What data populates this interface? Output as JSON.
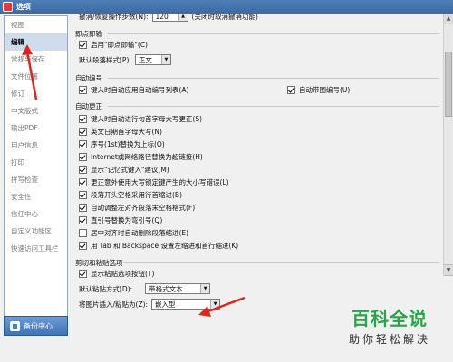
{
  "window": {
    "title": "选项"
  },
  "sidebar": {
    "items": [
      {
        "label": "视图"
      },
      {
        "label": "编辑"
      },
      {
        "label": "常规与保存"
      },
      {
        "label": "文件位置"
      },
      {
        "label": "修订"
      },
      {
        "label": "中文版式"
      },
      {
        "label": "输出PDF"
      },
      {
        "label": "用户信息"
      },
      {
        "label": "打印"
      },
      {
        "label": "拼写检查"
      },
      {
        "label": "安全性"
      },
      {
        "label": "信任中心"
      },
      {
        "label": "自定义功能区"
      },
      {
        "label": "快速访问工具栏"
      }
    ],
    "active_index": 1,
    "backup_label": "备份中心"
  },
  "top_row": {
    "label": "撤消/恢复操作步数(N):",
    "value": "120",
    "suffix": "(关闭时取消撤消功能)"
  },
  "jidian": {
    "title": "即点即输",
    "enable_label": "启用\"即点即输\"(C)",
    "enable_checked": true,
    "style_label": "默认段落样式(P):",
    "style_value": "正文"
  },
  "autonumber": {
    "title": "自动编号",
    "list_label": "键入时自动应用自动编号列表(A)",
    "list_checked": true,
    "circle_label": "自动带圈编号(U)",
    "circle_checked": true
  },
  "autocorrect": {
    "title": "自动更正",
    "items": [
      {
        "label": "键入时自动进行句首字母大写更正(S)",
        "checked": true
      },
      {
        "label": "英文日期首字母大写(N)",
        "checked": true
      },
      {
        "label": "序号(1st)替换为上标(O)",
        "checked": true
      },
      {
        "label": "Internet或网络路径替换为超链接(H)",
        "checked": true
      },
      {
        "label": "显示\"记忆式键入\"建议(M)",
        "checked": true
      },
      {
        "label": "更正意外使用大写锁定键产生的大小写错误(L)",
        "checked": true
      },
      {
        "label": "段落开头空格采用行首缩进(B)",
        "checked": true
      },
      {
        "label": "自动调整左对齐段落末空格格式(F)",
        "checked": true
      },
      {
        "label": "直引号替换为弯引号(Q)",
        "checked": true
      },
      {
        "label": "居中对齐时自动删除段落缩进(E)",
        "checked": false
      },
      {
        "label": "用 Tab 和 Backspace 设置左缩进和首行缩进(K)",
        "checked": true
      }
    ]
  },
  "paste": {
    "title": "剪切和粘贴选项",
    "show_btn_label": "显示粘贴选项按钮(T)",
    "show_btn_checked": true,
    "default_label": "默认粘贴方式(D):",
    "default_value": "带格式文本",
    "image_label": "将图片插入/粘贴为(Z):",
    "image_value": "嵌入型"
  },
  "watermark": {
    "main": "百科全说",
    "sub": "助你轻松解决"
  },
  "colors": {
    "accent": "#3c6aa1",
    "arrow": "#e0261c",
    "watermark": "#2aa24a"
  }
}
